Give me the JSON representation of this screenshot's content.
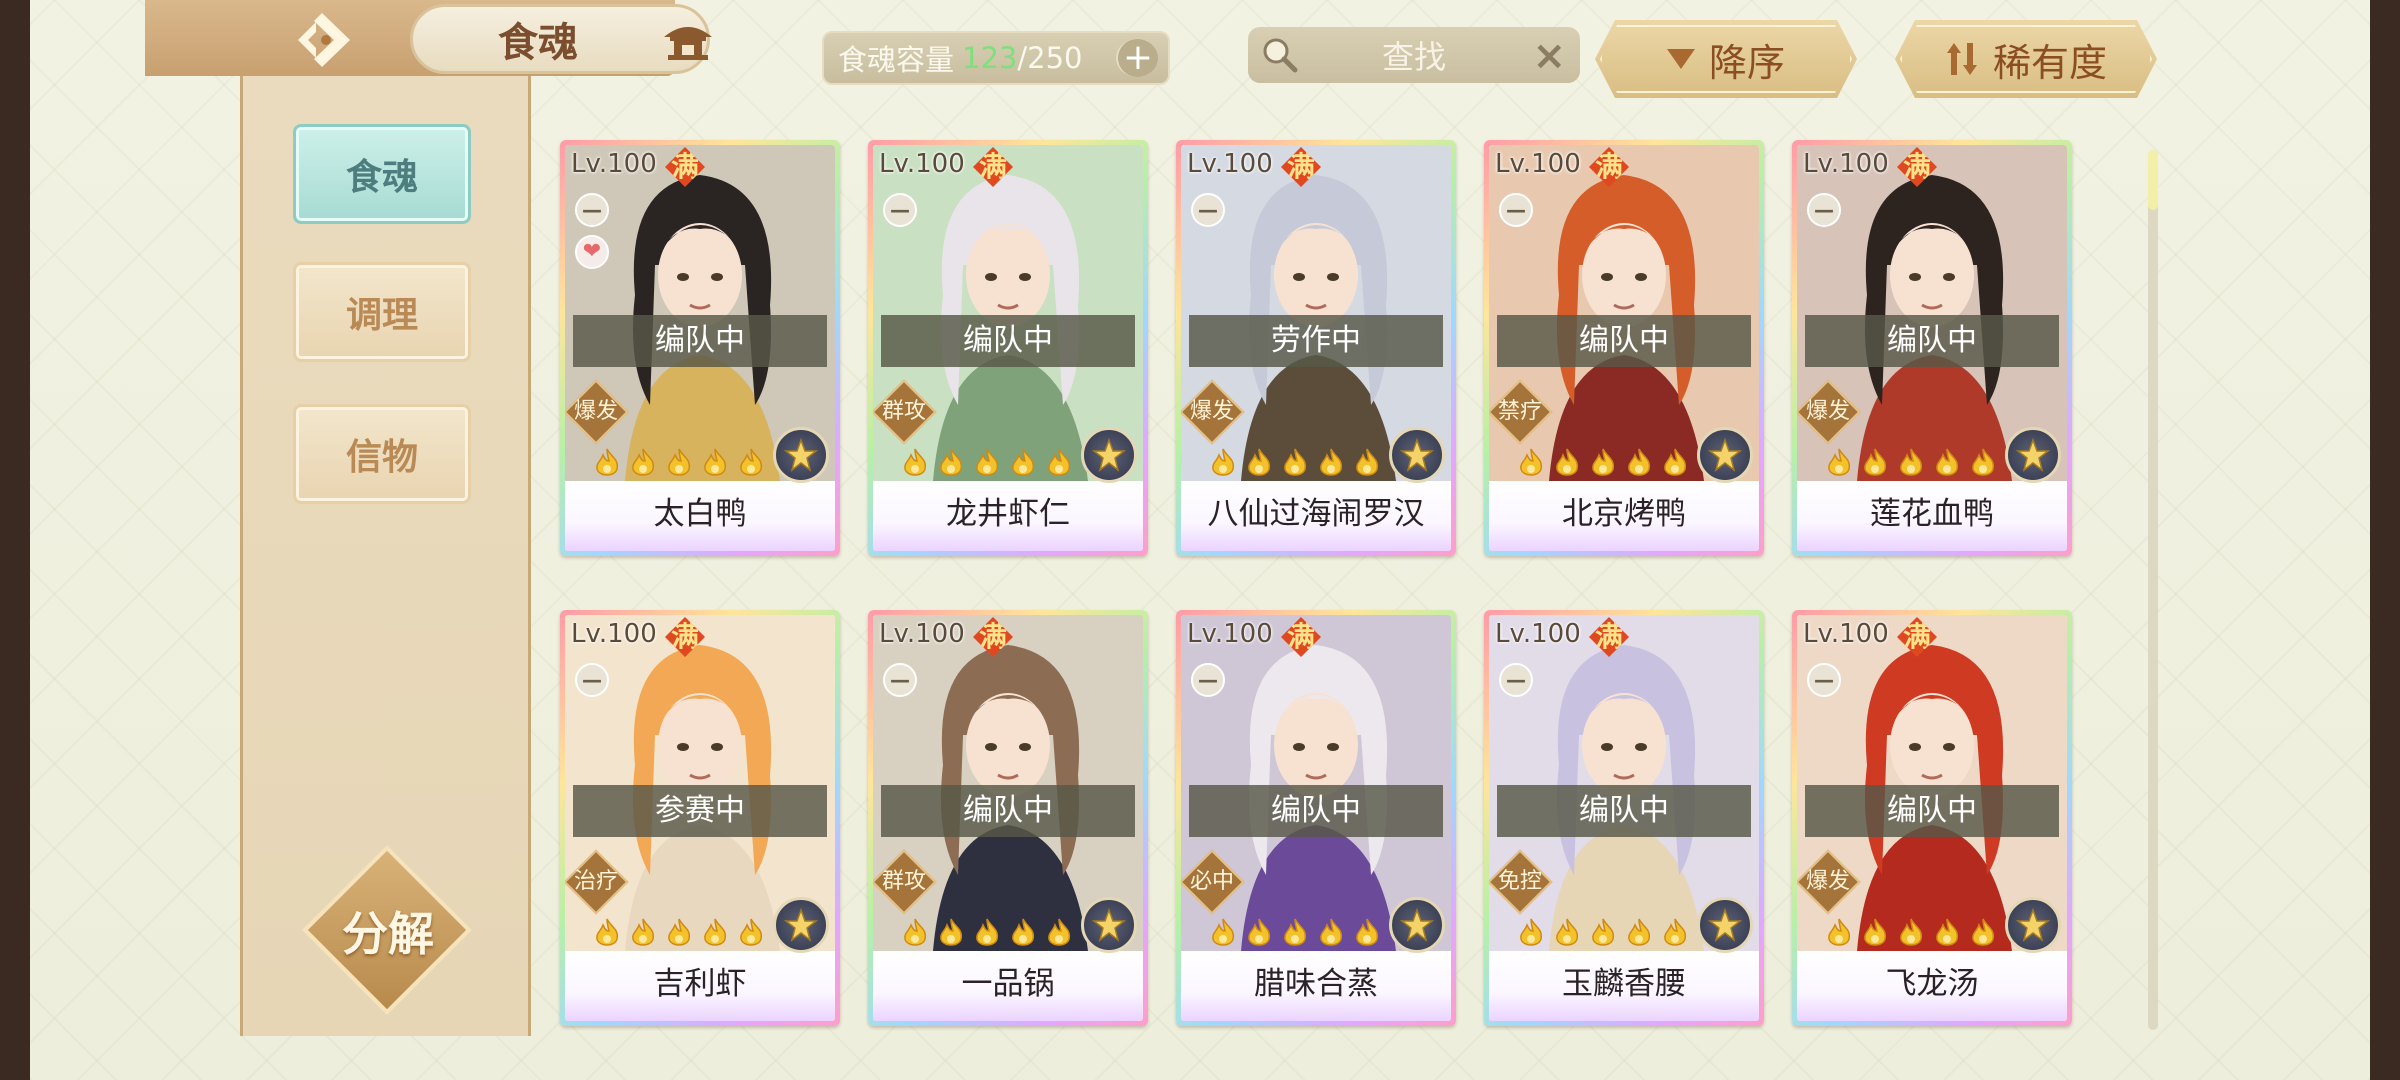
{
  "header": {
    "title": "食魂",
    "capacity_label": "食魂容量",
    "capacity_used": "123",
    "capacity_sep": "/",
    "capacity_total": "250",
    "search_placeholder": "查找",
    "sort_order_label": "降序",
    "sort_by_label": "稀有度"
  },
  "sidebar": {
    "items": [
      {
        "label": "食魂",
        "active": true
      },
      {
        "label": "调理",
        "active": false
      },
      {
        "label": "信物",
        "active": false
      }
    ],
    "decompose_label": "分解"
  },
  "cards": [
    {
      "level": "Lv.100",
      "full": "满",
      "status": "编队中",
      "role": "爆发",
      "name": "太白鸭",
      "heart": true,
      "bg": "#cfc8b8",
      "hair": "#2a2523",
      "robe": "#d6b35c"
    },
    {
      "level": "Lv.100",
      "full": "满",
      "status": "编队中",
      "role": "群攻",
      "name": "龙井虾仁",
      "heart": false,
      "bg": "#c9e0c2",
      "hair": "#e9e4ea",
      "robe": "#7fa27a"
    },
    {
      "level": "Lv.100",
      "full": "满",
      "status": "劳作中",
      "role": "爆发",
      "name": "八仙过海闹罗汉",
      "heart": false,
      "bg": "#d4d9e2",
      "hair": "#c6cad8",
      "robe": "#5b4d3a"
    },
    {
      "level": "Lv.100",
      "full": "满",
      "status": "编队中",
      "role": "禁疗",
      "name": "北京烤鸭",
      "heart": false,
      "bg": "#e8c9b0",
      "hair": "#d55d2a",
      "robe": "#8b2a24"
    },
    {
      "level": "Lv.100",
      "full": "满",
      "status": "编队中",
      "role": "爆发",
      "name": "莲花血鸭",
      "heart": false,
      "bg": "#d7c3b8",
      "hair": "#2d2420",
      "robe": "#b03a2a"
    },
    {
      "level": "Lv.100",
      "full": "满",
      "status": "参赛中",
      "role": "治疗",
      "name": "吉利虾",
      "heart": false,
      "bg": "#f3e4cd",
      "hair": "#f2a854",
      "robe": "#e9d8c0"
    },
    {
      "level": "Lv.100",
      "full": "满",
      "status": "编队中",
      "role": "群攻",
      "name": "一品锅",
      "heart": false,
      "bg": "#d8d0c0",
      "hair": "#8c6d54",
      "robe": "#2e3040"
    },
    {
      "level": "Lv.100",
      "full": "满",
      "status": "编队中",
      "role": "必中",
      "name": "腊味合蒸",
      "heart": false,
      "bg": "#cfc6d6",
      "hair": "#ece8ee",
      "robe": "#6b4a9a"
    },
    {
      "level": "Lv.100",
      "full": "满",
      "status": "编队中",
      "role": "免控",
      "name": "玉麟香腰",
      "heart": false,
      "bg": "#e2dbe8",
      "hair": "#c8c2e0",
      "robe": "#e6d6b6"
    },
    {
      "level": "Lv.100",
      "full": "满",
      "status": "编队中",
      "role": "爆发",
      "name": "飞龙汤",
      "heart": false,
      "bg": "#eed8c6",
      "hair": "#cf3a22",
      "robe": "#b52a1e"
    }
  ],
  "colors": {
    "accent_teal": "#a6dbd2",
    "gold": "#d9bd83",
    "capacity_used": "#7de07d"
  },
  "icons": {
    "back": "back-arrow-icon",
    "home": "home-pavilion-icon",
    "search": "magnifier-icon",
    "clear": "close-x-icon",
    "sort_desc": "triangle-down-icon",
    "sort_rarity": "sort-arrows-icon",
    "element": "flower-emblem-icon",
    "star": "flame-star-icon"
  }
}
